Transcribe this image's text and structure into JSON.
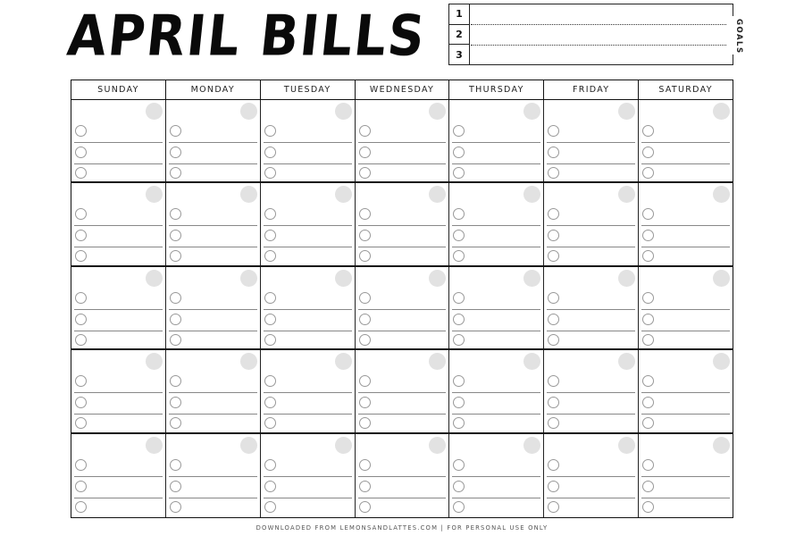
{
  "title": "APRIL BILLS",
  "goals": {
    "label": "GOALS",
    "numbers": [
      "1",
      "2",
      "3"
    ]
  },
  "calendar": {
    "days": [
      "SUNDAY",
      "MONDAY",
      "TUESDAY",
      "WEDNESDAY",
      "THURSDAY",
      "FRIDAY",
      "SATURDAY"
    ],
    "weeks": 5,
    "checklist_items_per_day": 3
  },
  "footer": "DOWNLOADED FROM LEMONSANDLATTES.COM | FOR PERSONAL USE ONLY"
}
